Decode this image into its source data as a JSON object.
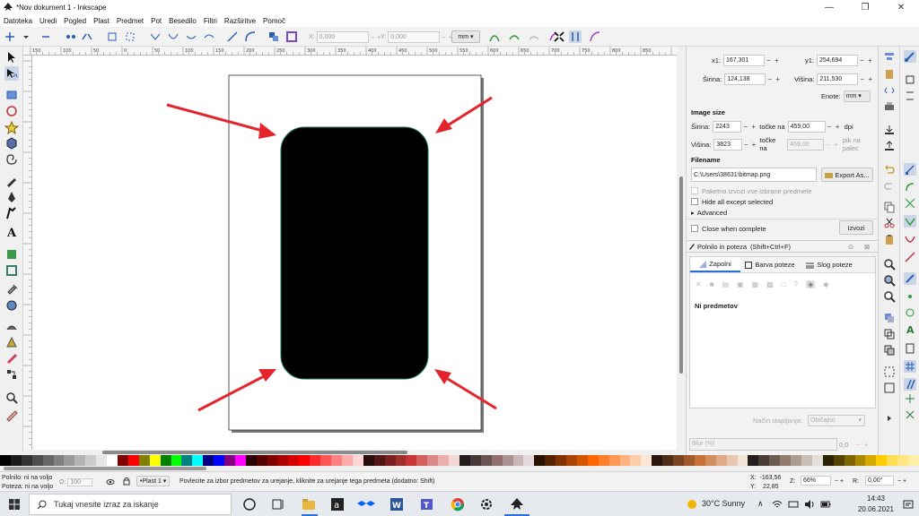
{
  "window": {
    "title": "*Nov dokument 1 - Inkscape",
    "minimize": "—",
    "maximize": "❐",
    "close": "✕"
  },
  "menu": [
    "Datoteka",
    "Uredi",
    "Pogled",
    "Plast",
    "Predmet",
    "Pot",
    "Besedilo",
    "Filtri",
    "Razširitve",
    "Pomoč"
  ],
  "tool_controls": {
    "x_label": "X:",
    "x_value": "0,000",
    "y_label": "Y:",
    "y_value": "0,000",
    "unit": "mm"
  },
  "ruler_ticks": [
    "150",
    "100",
    "50",
    "0",
    "50",
    "100",
    "150",
    "200",
    "250",
    "300",
    "350",
    "400",
    "450",
    "500",
    "550",
    "600",
    "650",
    "700",
    "750",
    "800",
    "850"
  ],
  "export": {
    "x1_label": "x1:",
    "x1_value": "167,301",
    "y1_label": "y1:",
    "y1_value": "254,694",
    "width_label": "Širina:",
    "width_value": "124,138",
    "height_label": "Višina:",
    "height_value": "211,530",
    "units_label": "Enote:",
    "units_value": "mm",
    "image_size_heading": "Image size",
    "img_width_label": "Širina:",
    "img_width_value": "2243",
    "dpi_at_label": "točke na",
    "dpi_value": "459,00",
    "dpi_unit": "dpi",
    "img_height_label": "Višina:",
    "img_height_value": "3823",
    "ppi_at_label": "točke na",
    "ppi_value": "459,00",
    "ppi_unit": "pik na palec",
    "filename_heading": "Filename",
    "filename_value": "C:\\Users\\38631\\bitmap.png",
    "export_as_label": "Export As...",
    "batch_export_label": "Paketno izvozi vse izbrane predmete",
    "hide_except_label": "Hide all except selected",
    "advanced_label": "Advanced",
    "close_when_complete_label": "Close when complete",
    "export_button": "Izvozi"
  },
  "fill_stroke": {
    "title": "Polnilo in poteza",
    "shortcut": "(Shift+Ctrl+F)",
    "tabs": [
      "Zapolni",
      "Barva poteze",
      "Slog poteze"
    ],
    "no_objects": "Ni predmetov",
    "blend_label": "Način stapljanja:",
    "blend_value": "Običajno",
    "blur_label": "Blur (%)",
    "blur_value": "0,0"
  },
  "status": {
    "fill_label": "Polnilo:",
    "fill_value": "ni na voljo",
    "stroke_label": "Poteza:",
    "stroke_value": "ni na voljo",
    "opacity_label": "O:",
    "opacity_value": "100",
    "layer": "•Plast 1",
    "message": "Povlecite za izbor predmetov za urejanje, kliknite za urejanje tega predmeta (dodatno: Shift)",
    "x_label": "X:",
    "x_value": "-163,56",
    "y_label": "Y:",
    "y_value": "22,85",
    "zoom_label": "Z:",
    "zoom_value": "66%",
    "rotation_label": "R:",
    "rotation_value": "0,00°"
  },
  "taskbar": {
    "search_placeholder": "Tukaj vnesite izraz za iskanje",
    "weather": "30°C Sunny",
    "time": "14:43",
    "date": "20.06.2021"
  },
  "colors": {
    "accent": "#2a6fd6",
    "arrow": "#e3242b",
    "shape": "#000000",
    "shape_stroke": "#1b6e5a"
  },
  "palette": [
    "#000000",
    "#1a1a1a",
    "#333333",
    "#4d4d4d",
    "#666666",
    "#808080",
    "#999999",
    "#b3b3b3",
    "#cccccc",
    "#e6e6e6",
    "#ffffff",
    "#800000",
    "#ff0000",
    "#808000",
    "#ffff00",
    "#008000",
    "#00ff00",
    "#008080",
    "#00ffff",
    "#000080",
    "#0000ff",
    "#800080",
    "#ff00ff",
    "#2b0000",
    "#550000",
    "#800000",
    "#aa0000",
    "#d40000",
    "#ff0000",
    "#ff2a2a",
    "#ff5555",
    "#ff8080",
    "#ffaaaa",
    "#ffd5d5",
    "#280b0b",
    "#501616",
    "#782121",
    "#a02c2c",
    "#c83737",
    "#d35f5f",
    "#de8787",
    "#e9afaf",
    "#f4d7d7",
    "#241c1c",
    "#483737",
    "#6c5353",
    "#916f6f",
    "#ac9393",
    "#c8b7b7",
    "#e3dbdb",
    "#2b1100",
    "#552200",
    "#803300",
    "#aa4400",
    "#d45500",
    "#ff6600",
    "#ff7f2a",
    "#ff9955",
    "#ffb380",
    "#ffccaa",
    "#ffe6d5",
    "#28170b",
    "#502d16",
    "#784421",
    "#a05a2c",
    "#c87137",
    "#d38d5f",
    "#deaa87",
    "#e9c6af",
    "#f4e3d7",
    "#241f1c",
    "#483e37",
    "#6c5d53",
    "#917c6f",
    "#ac9d93",
    "#c8beb7",
    "#e3dedb",
    "#2b2200",
    "#554400",
    "#806600",
    "#aa8800",
    "#d4aa00",
    "#ffcc00",
    "#ffdd55",
    "#ffe680",
    "#ffeeaa"
  ]
}
